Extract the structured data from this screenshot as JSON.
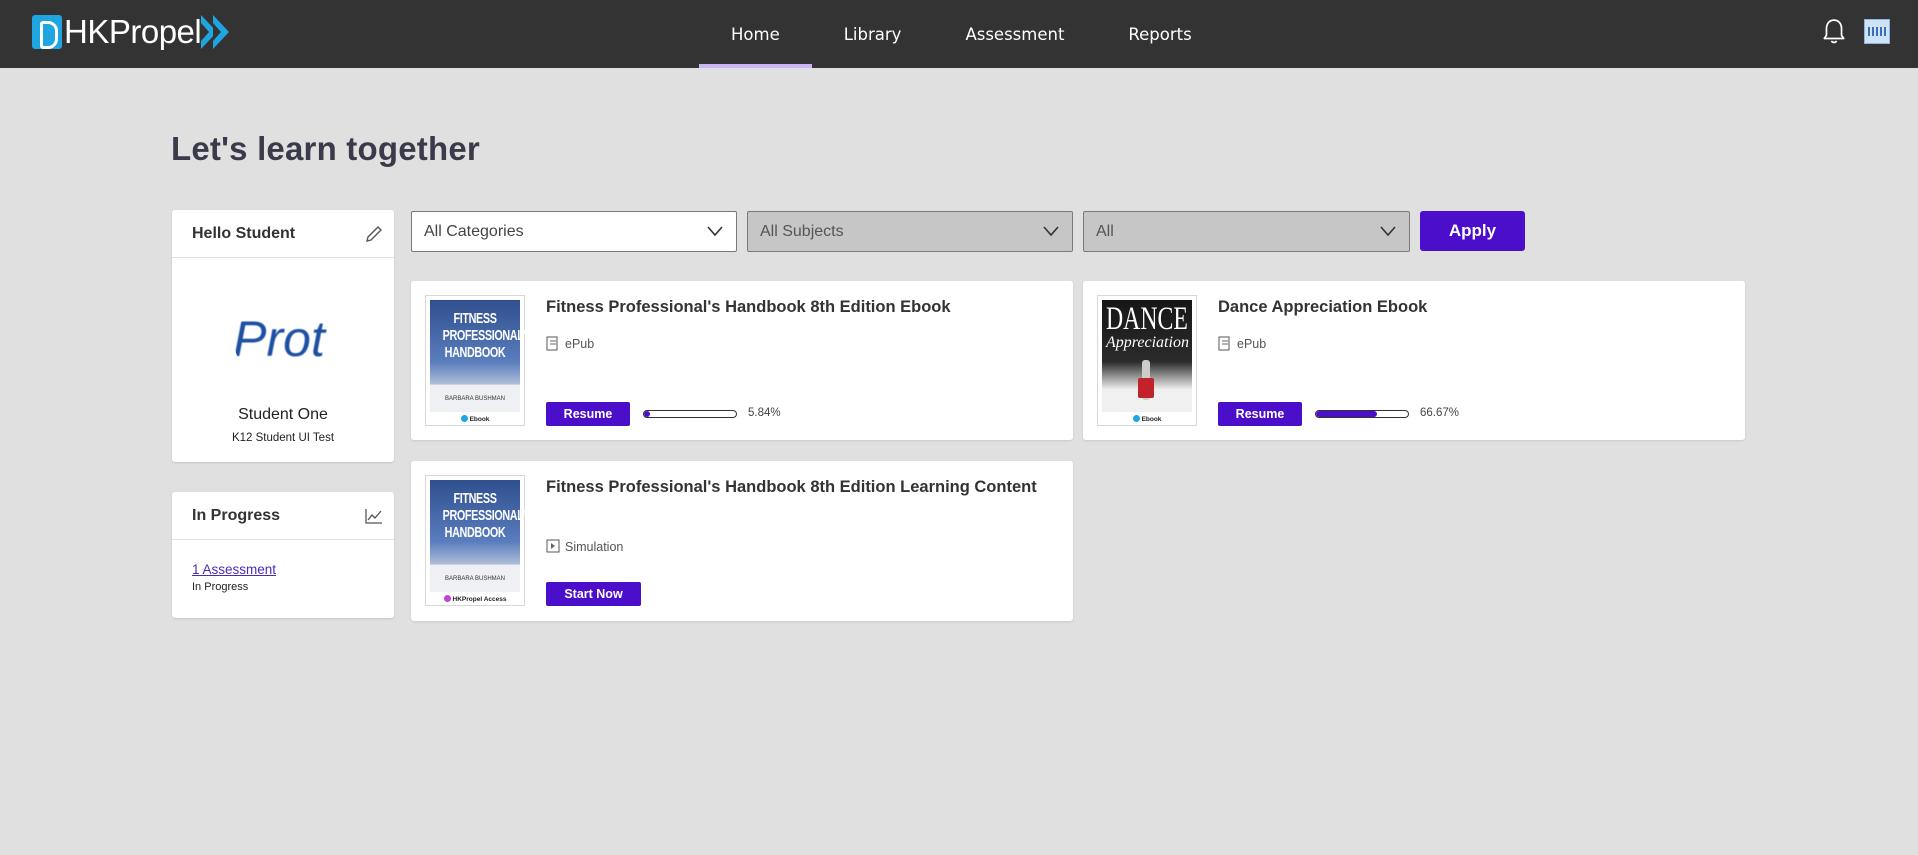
{
  "header": {
    "logo_text": "HKPropel",
    "nav": [
      {
        "label": "Home",
        "active": true
      },
      {
        "label": "Library",
        "active": false
      },
      {
        "label": "Assessment",
        "active": false
      },
      {
        "label": "Reports",
        "active": false
      }
    ],
    "nav_underline_color": "#c9b6f2",
    "icons": [
      "bell-icon",
      "user-avatar"
    ]
  },
  "page": {
    "title": "Let's learn together"
  },
  "profile": {
    "heading": "Hello Student",
    "edit_icon": "pencil-icon",
    "avatar_text": "Prot",
    "name": "Student One",
    "subtitle": "K12 Student UI Test"
  },
  "in_progress": {
    "heading": "In Progress",
    "icon": "line-chart-icon",
    "link_text": "1 Assessment",
    "link_sub": "In Progress"
  },
  "filters": {
    "categories": "All Categories",
    "subjects": "All Subjects",
    "third": "All",
    "apply_label": "Apply"
  },
  "colors": {
    "accent": "#4b0ecb",
    "topbar": "#333333",
    "background": "#e0e0e0"
  },
  "cards": [
    {
      "title": "Fitness Professional's Handbook 8th Edition Ebook",
      "format": "ePub",
      "format_icon": "epub-icon",
      "action": "Resume",
      "progress": "5.84%",
      "progress_value": 5.84,
      "cover_title": "FITNESS PROFESSIONAL'S HANDBOOK",
      "cover_author": "BARBARA BUSHMAN",
      "badge": "Ebook",
      "badge_color": "#1fa5e0"
    },
    {
      "title": "Dance Appreciation Ebook",
      "format": "ePub",
      "format_icon": "epub-icon",
      "action": "Resume",
      "progress": "66.67%",
      "progress_value": 66.67,
      "cover_title": "DANCE",
      "cover_subtitle": "Appreciation",
      "badge": "Ebook",
      "badge_color": "#1fa5e0"
    },
    {
      "title": "Fitness Professional's Handbook 8th Edition Learning Content",
      "format": "Simulation",
      "format_icon": "simulation-icon",
      "action": "Start Now",
      "cover_title": "FITNESS PROFESSIONAL'S HANDBOOK",
      "cover_author": "BARBARA BUSHMAN",
      "badge": "HKPropel Access",
      "badge_color": "#c043d8"
    }
  ]
}
